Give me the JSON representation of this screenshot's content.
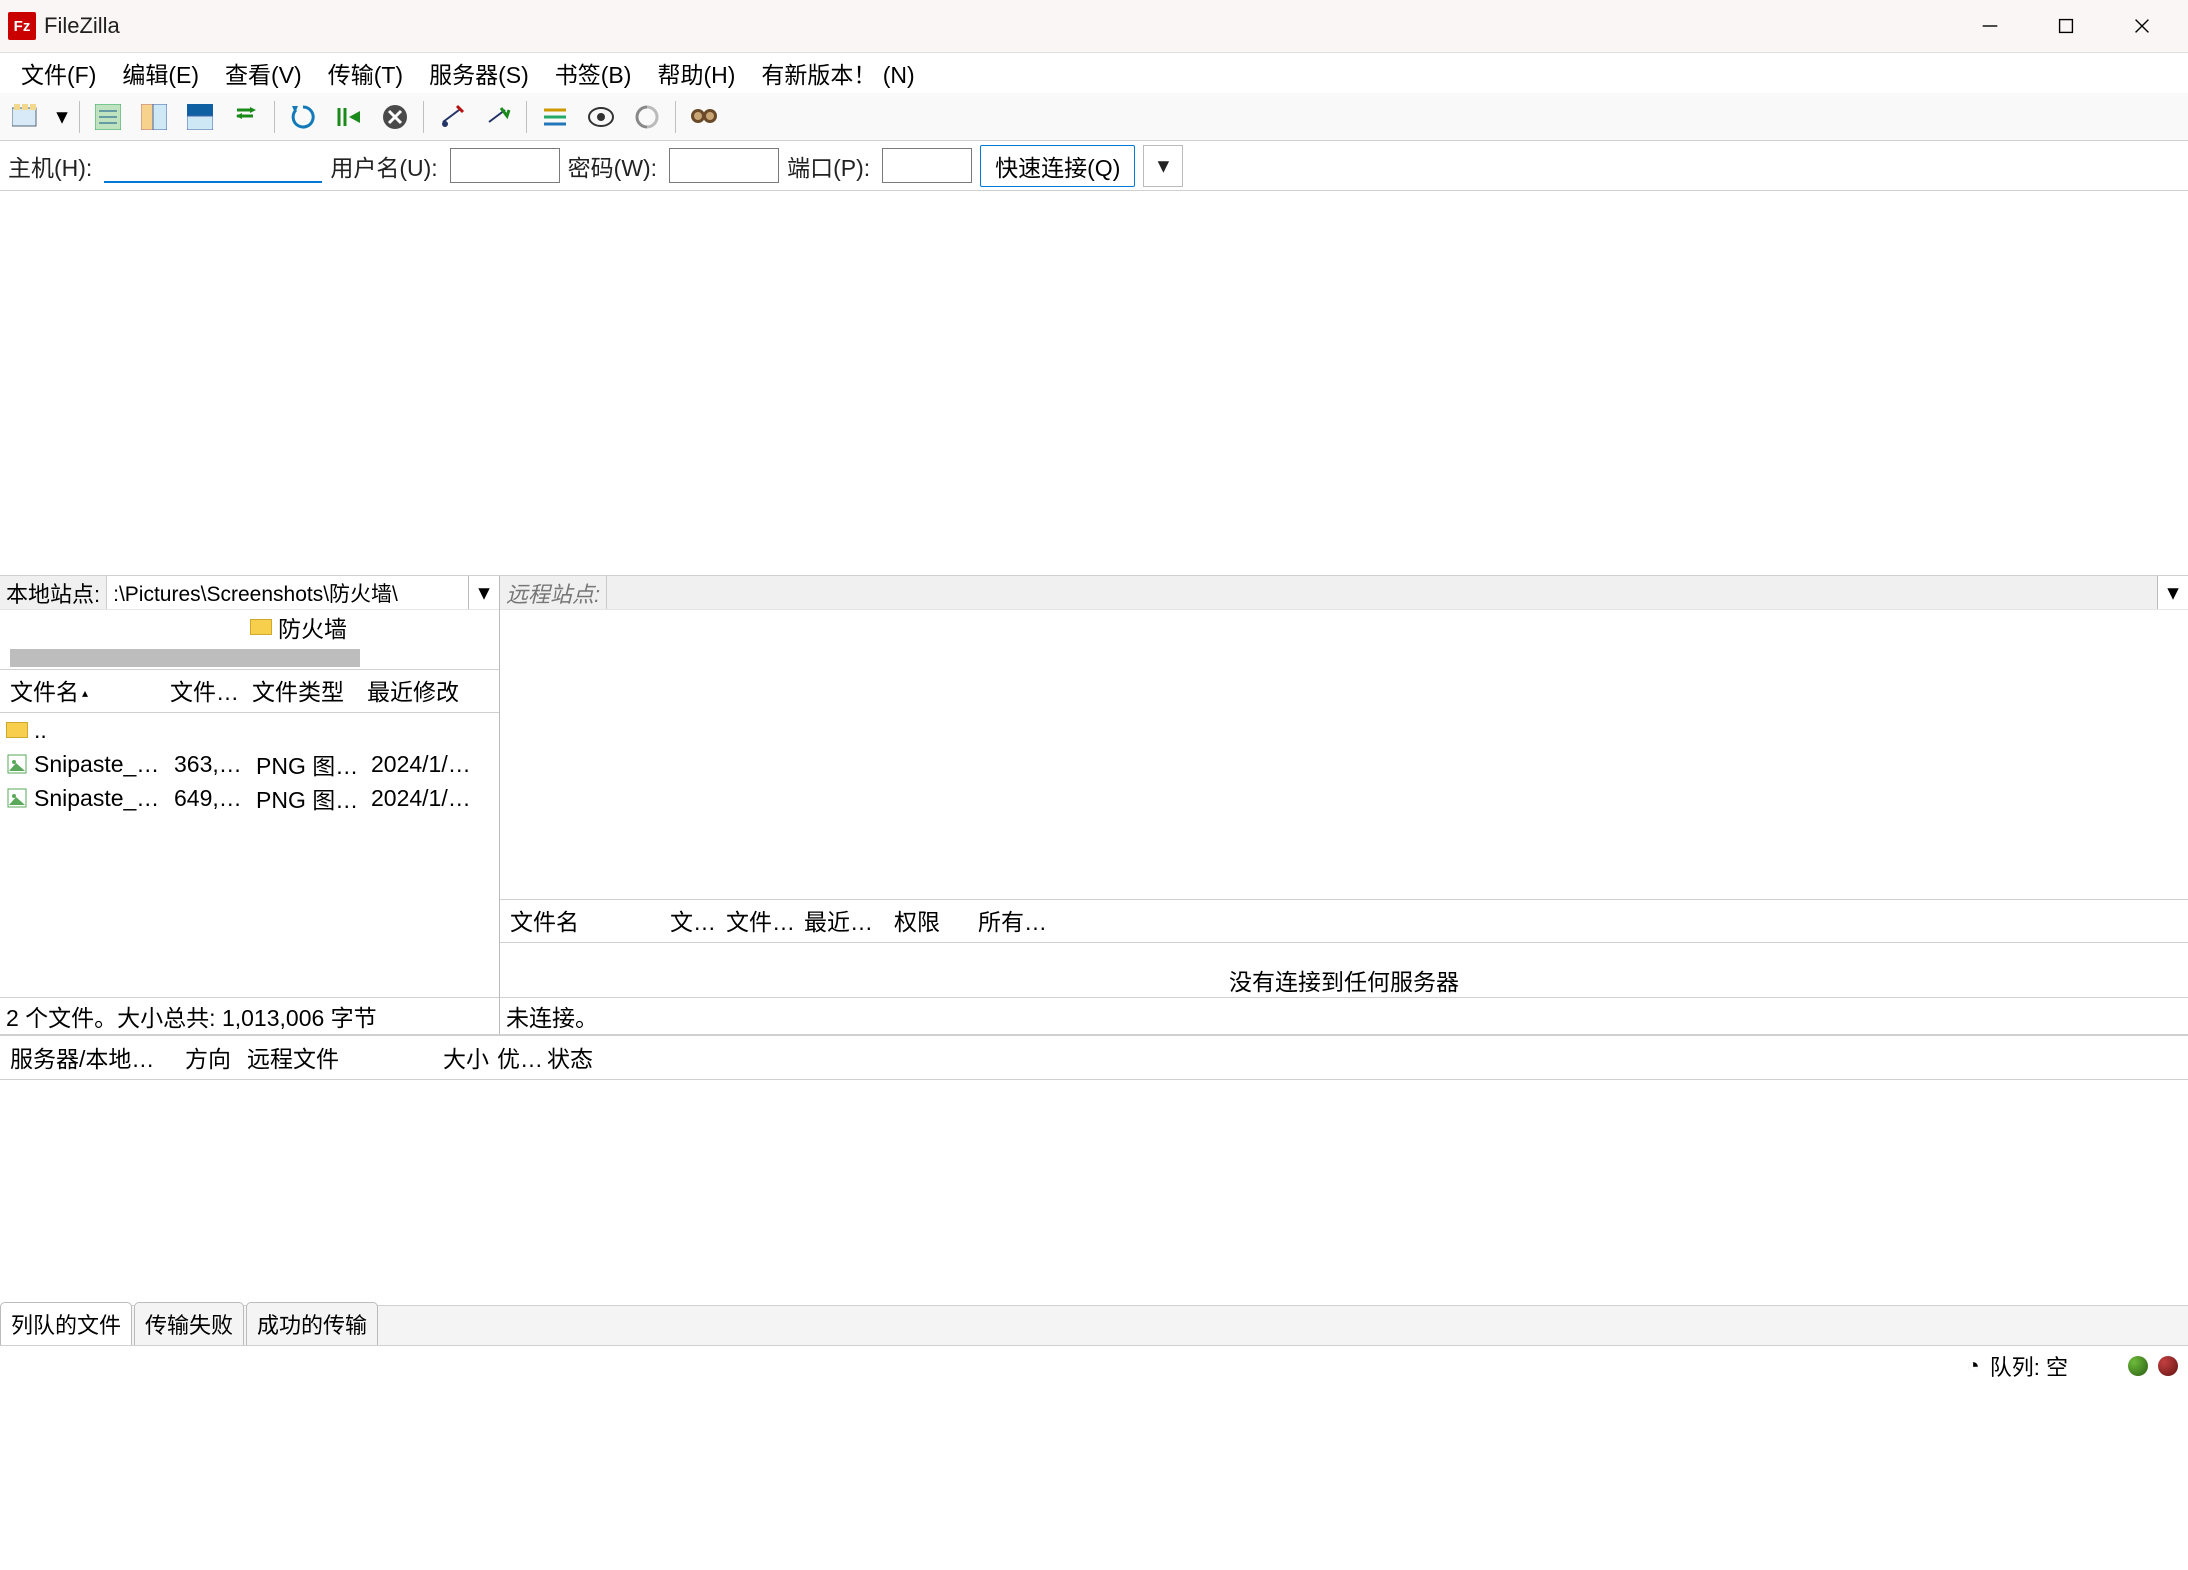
{
  "title": "FileZilla",
  "menus": {
    "file": "文件(F)",
    "edit": "编辑(E)",
    "view": "查看(V)",
    "transfer": "传输(T)",
    "server": "服务器(S)",
    "bookmark": "书签(B)",
    "help": "帮助(H)",
    "newver": "有新版本！ (N)"
  },
  "qc": {
    "host": "主机(H):",
    "user": "用户名(U):",
    "pass": "密码(W):",
    "port": "端口(P):",
    "btn": "快速连接(Q)"
  },
  "local": {
    "label": "本地站点:",
    "path": ":\\Pictures\\Screenshots\\防火墙\\",
    "tree_folder": "防火墙",
    "cols": {
      "name": "文件名",
      "size": "文件…",
      "type": "文件类型",
      "mod": "最近修改"
    },
    "parent": "..",
    "rows": [
      {
        "name": "Snipaste_…",
        "size": "363,…",
        "type": "PNG 图…",
        "mod": "2024/1/…"
      },
      {
        "name": "Snipaste_…",
        "size": "649,…",
        "type": "PNG 图…",
        "mod": "2024/1/…"
      }
    ],
    "status": "2 个文件。大小总共: 1,013,006 字节"
  },
  "remote": {
    "label": "远程站点:",
    "cols": {
      "name": "文件名",
      "size": "文…",
      "type": "文件…",
      "mod": "最近…",
      "perm": "权限",
      "owner": "所有…"
    },
    "msg": "没有连接到任何服务器",
    "status": "未连接。"
  },
  "queue": {
    "cols": {
      "server": "服务器/本地…",
      "dir": "方向",
      "remote": "远程文件",
      "size": "大小",
      "pri": "优…",
      "status": "状态"
    },
    "tabs": {
      "queued": "列队的文件",
      "failed": "传输失败",
      "succeeded": "成功的传输"
    }
  },
  "sb": {
    "queue": "队列: 空"
  }
}
